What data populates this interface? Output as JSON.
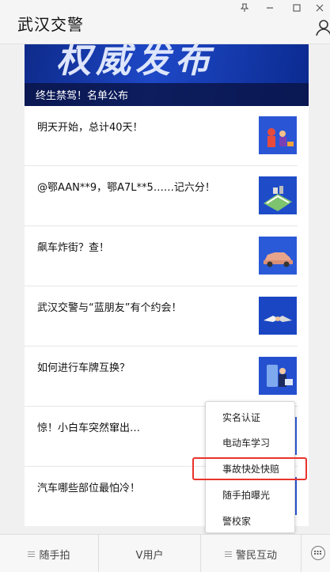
{
  "window": {
    "title": "武汉交警",
    "buttons": {
      "pin": "pin-icon",
      "minimize": "minimize-icon",
      "maximize": "maximize-icon",
      "close": "close-icon"
    }
  },
  "banner": {
    "big_text": "权威发布",
    "caption": "终生禁驾！名单公布"
  },
  "news": [
    {
      "title": "明天开始，总计40天！"
    },
    {
      "title": "@鄂AAN**9，鄂A7L**5……记六分！"
    },
    {
      "title": "飙车炸街？查！"
    },
    {
      "title": "武汉交警与“蓝朋友”有个约会！"
    },
    {
      "title": "如何进行车牌互换？"
    },
    {
      "title": "惊！小白车突然窜出…"
    },
    {
      "title": "汽车哪些部位最怕冷！"
    }
  ],
  "popup_menu": {
    "items": [
      "实名认证",
      "电动车学习",
      "事故快处快赔",
      "随手拍曝光",
      "警校家"
    ],
    "highlight_color": "#e8342c"
  },
  "bottom_tabs": {
    "tab1": "随手拍",
    "tab2": "V用户",
    "tab3": "警民互动"
  },
  "colors": {
    "accent_blue": "#1e48c7",
    "highlight_red": "#e8342c"
  }
}
